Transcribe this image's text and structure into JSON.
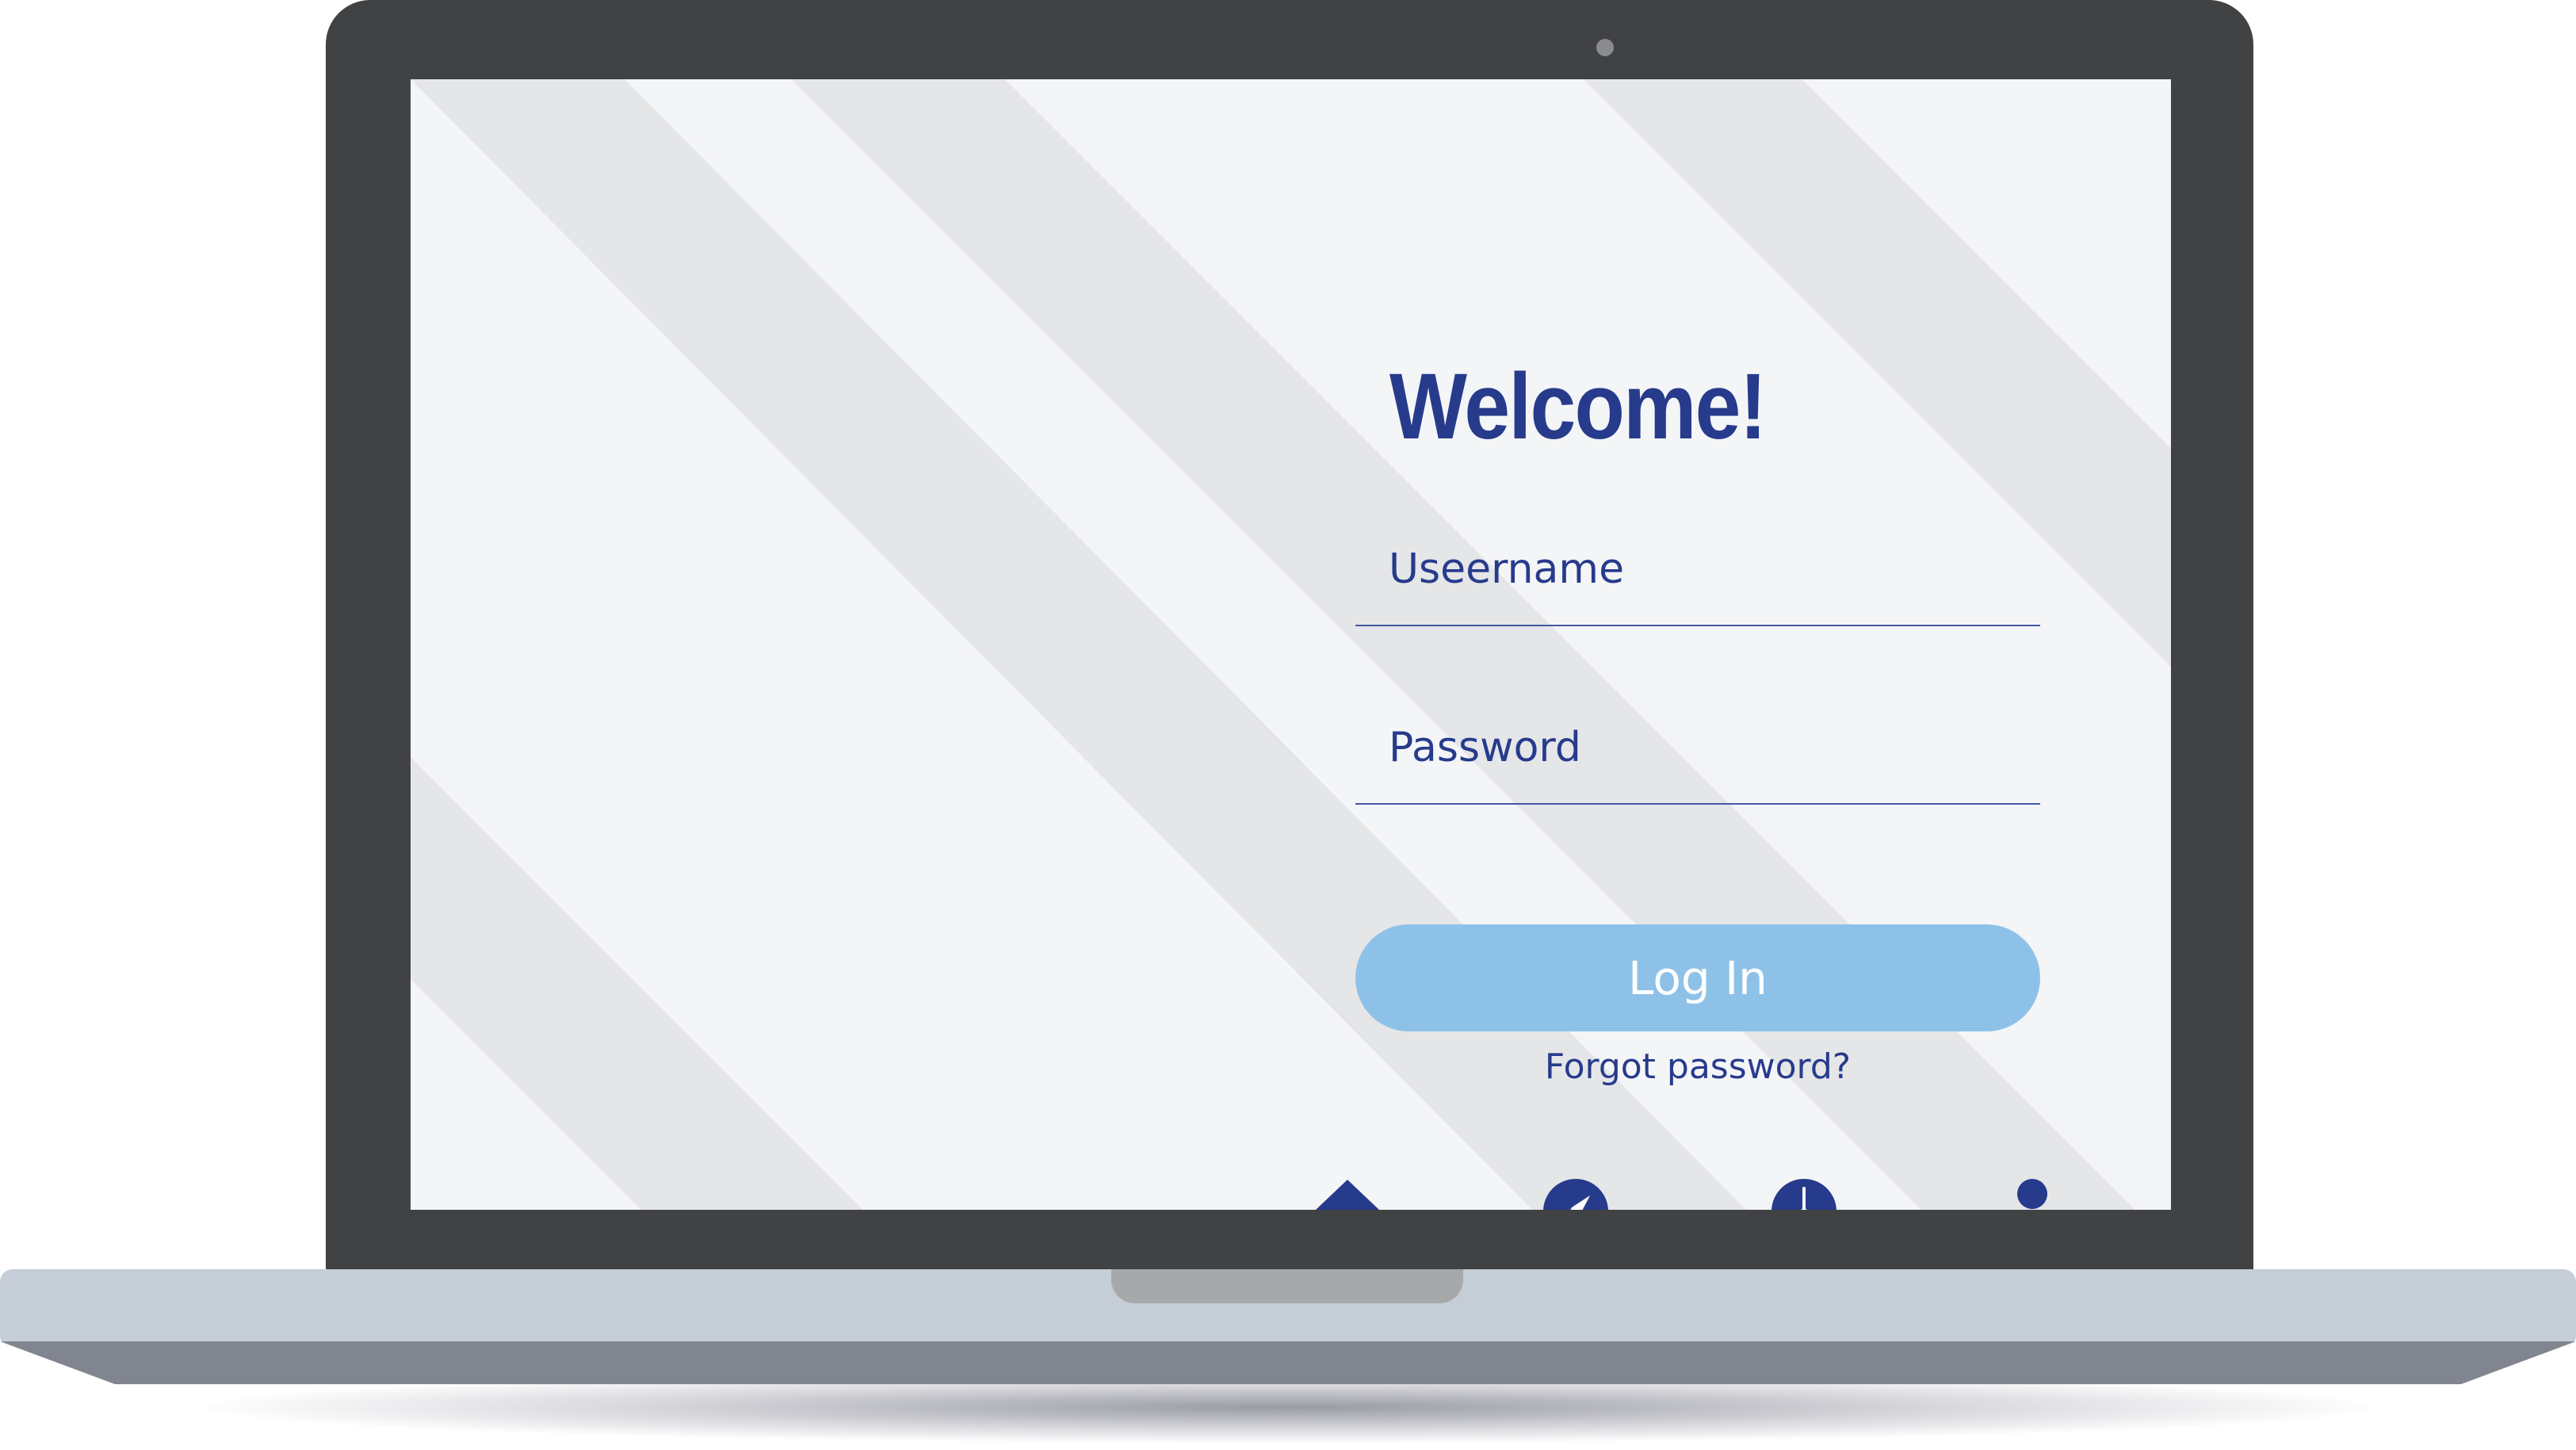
{
  "login": {
    "title": "Welcome!",
    "username_label": "Useername",
    "password_label": "Password",
    "login_button_label": "Log In",
    "forgot_password_label": "Forgot password?"
  },
  "bottom_nav": {
    "items": [
      {
        "icon": "home-icon"
      },
      {
        "icon": "compass-icon"
      },
      {
        "icon": "clock-icon"
      },
      {
        "icon": "user-icon"
      }
    ]
  },
  "colors": {
    "accent": "#273b8c",
    "button": "#8ec1e8",
    "screen_background": "#f4f5f7",
    "stripe": "#e5e6e8",
    "laptop_frame": "#414244",
    "laptop_base": "#c5cdd6"
  }
}
